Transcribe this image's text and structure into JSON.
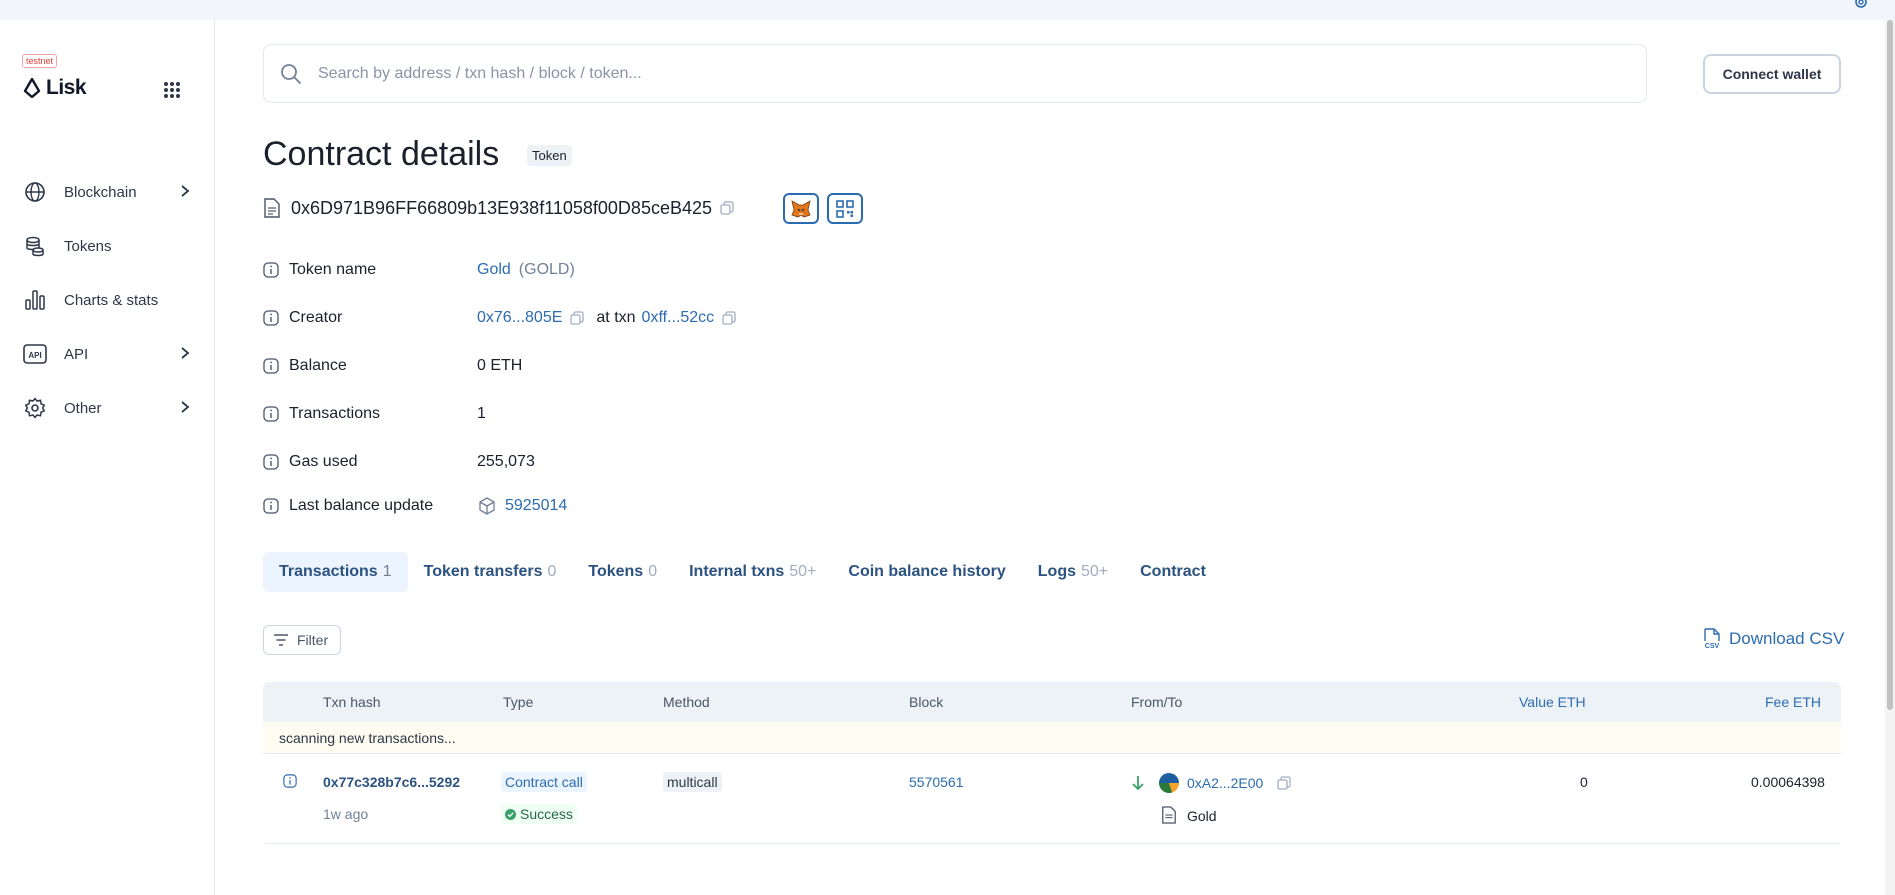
{
  "header": {
    "search_placeholder": "Search by address / txn hash / block / token...",
    "connect_wallet": "Connect wallet"
  },
  "sidebar": {
    "network_badge": "testnet",
    "logo_text": "Lisk",
    "items": [
      {
        "label": "Blockchain",
        "icon": "globe-icon",
        "has_submenu": true
      },
      {
        "label": "Tokens",
        "icon": "coins-icon",
        "has_submenu": false
      },
      {
        "label": "Charts & stats",
        "icon": "bar-chart-icon",
        "has_submenu": false
      },
      {
        "label": "API",
        "icon": "api-icon",
        "has_submenu": true
      },
      {
        "label": "Other",
        "icon": "gear-icon",
        "has_submenu": true
      }
    ]
  },
  "page": {
    "title": "Contract details",
    "title_tag": "Token",
    "address": "0x6D971B96FF66809b13E938f11058f00D85ceB425"
  },
  "details": {
    "token_name_label": "Token name",
    "token_name": "Gold",
    "token_symbol": "(GOLD)",
    "creator_label": "Creator",
    "creator_address": "0x76...805E",
    "creator_at_txn": "at txn",
    "creator_txn": "0xff...52cc",
    "balance_label": "Balance",
    "balance": "0 ETH",
    "transactions_label": "Transactions",
    "transactions": "1",
    "gas_used_label": "Gas used",
    "gas_used": "255,073",
    "last_balance_update_label": "Last balance update",
    "last_balance_update": "5925014"
  },
  "tabs": [
    {
      "label": "Transactions",
      "count": "1",
      "active": true
    },
    {
      "label": "Token transfers",
      "count": "0"
    },
    {
      "label": "Tokens",
      "count": "0"
    },
    {
      "label": "Internal txns",
      "count": "50+"
    },
    {
      "label": "Coin balance history",
      "count": ""
    },
    {
      "label": "Logs",
      "count": "50+"
    },
    {
      "label": "Contract",
      "count": ""
    }
  ],
  "toolbar": {
    "filter_label": "Filter",
    "download_csv": "Download CSV"
  },
  "table": {
    "columns": {
      "txn_hash": "Txn hash",
      "type": "Type",
      "method": "Method",
      "block": "Block",
      "from_to": "From/To",
      "value": "Value ETH",
      "fee": "Fee ETH"
    },
    "scanning_text": "scanning new transactions...",
    "rows": [
      {
        "hash": "0x77c328b7c6...5292",
        "age": "1w ago",
        "type": "Contract call",
        "status": "Success",
        "method": "multicall",
        "block": "5570561",
        "from": "0xA2...2E00",
        "to": "Gold",
        "value": "0",
        "fee": "0.00064398"
      }
    ]
  }
}
